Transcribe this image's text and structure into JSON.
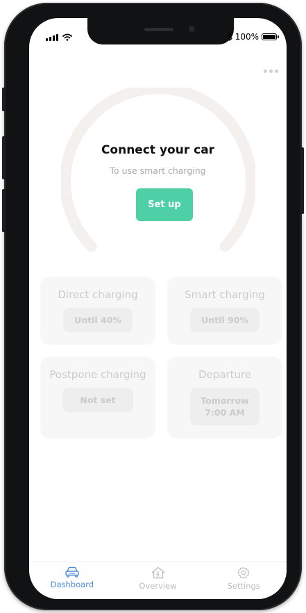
{
  "status_bar": {
    "battery_text": "100%"
  },
  "header": {
    "more_icon": "ellipsis-icon"
  },
  "connect": {
    "title": "Connect your car",
    "subtitle": "To use smart charging",
    "setup_label": "Set up"
  },
  "cards": {
    "direct": {
      "title": "Direct charging",
      "value": "Until 40%"
    },
    "smart": {
      "title": "Smart charging",
      "value": "Until 90%"
    },
    "postpone": {
      "title": "Postpone charging",
      "value": "Not set"
    },
    "departure": {
      "title": "Departure",
      "value_line1": "Tomorrow",
      "value_line2": "7:00 AM"
    }
  },
  "tabs": {
    "dashboard": {
      "label": "Dashboard",
      "icon": "car-icon"
    },
    "overview": {
      "label": "Overview",
      "icon": "house-icon"
    },
    "settings": {
      "label": "Settings",
      "icon": "gear-icon"
    }
  },
  "colors": {
    "accent": "#4fcfa6",
    "active_tab": "#4b8bd6",
    "gauge_track": "#f3f0ee",
    "disabled_text": "#cbcbcb"
  }
}
